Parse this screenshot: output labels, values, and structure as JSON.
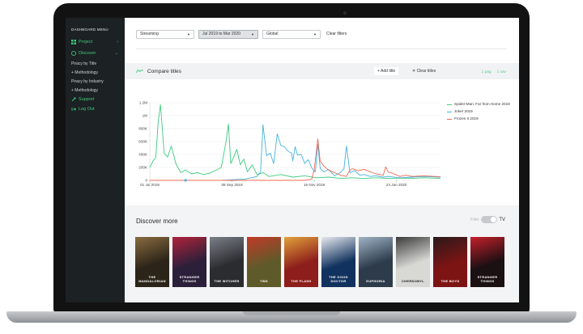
{
  "sidebar": {
    "title": "DASHBOARD MENU",
    "items": [
      {
        "label": "Project",
        "icon": "grid-icon"
      },
      {
        "label": "Discover",
        "icon": "compass-icon"
      }
    ],
    "discover_sub": [
      {
        "label": "Piracy by Title"
      },
      {
        "label": "+ Methodology"
      },
      {
        "label": "Piracy by Industry"
      },
      {
        "label": "+ Methodology"
      }
    ],
    "support": {
      "label": "Support",
      "icon": "support-icon"
    },
    "logout": {
      "label": "Log Out",
      "icon": "logout-icon"
    }
  },
  "filters": {
    "type": "Streaming",
    "date": "Jul 2019 to Mar 2020",
    "region": "Global",
    "clear": "Clear filters"
  },
  "compare": {
    "title": "Compare titles",
    "add": "+ Add title",
    "clear": "✕  Clear titles",
    "png": "⇩ png",
    "csv": "⇩ csv"
  },
  "chart_data": {
    "type": "line",
    "title": "",
    "xlabel": "",
    "ylabel": "",
    "x_ticks": [
      "01 Jul 2019",
      "08 Sep 2019",
      "16 Nov 2019",
      "24 Jan 2020"
    ],
    "y_ticks": [
      "0",
      "200K",
      "400K",
      "600K",
      "800K",
      "1M",
      "1.2M"
    ],
    "ylim": [
      0,
      1200000
    ],
    "x_range_days": [
      0,
      244
    ],
    "series": [
      {
        "name": "Spider-Man: Far from Home 2019",
        "color": "#3ecb7e",
        "x": [
          0,
          3,
          5,
          7,
          9,
          12,
          15,
          18,
          22,
          26,
          30,
          35,
          40,
          45,
          50,
          55,
          60,
          64,
          66,
          68,
          70,
          73,
          76,
          79,
          82,
          86,
          90,
          95,
          100,
          110,
          120,
          130,
          140,
          150,
          160,
          170,
          180,
          190,
          200,
          210,
          220,
          230,
          244
        ],
        "y": [
          200000,
          310000,
          350000,
          900000,
          1170000,
          420000,
          360000,
          530000,
          250000,
          120000,
          160000,
          100000,
          120000,
          90000,
          110000,
          150000,
          200000,
          600000,
          870000,
          260000,
          340000,
          480000,
          240000,
          330000,
          130000,
          240000,
          90000,
          120000,
          60000,
          90000,
          50000,
          70000,
          40000,
          50000,
          30000,
          40000,
          30000,
          40000,
          30000,
          35000,
          30000,
          40000,
          30000
        ]
      },
      {
        "name": "Joker 2019",
        "color": "#46b3de",
        "x": [
          0,
          20,
          40,
          60,
          70,
          80,
          90,
          93,
          95,
          98,
          101,
          104,
          107,
          110,
          113,
          116,
          119,
          120,
          122,
          124,
          127,
          130,
          133,
          136,
          139,
          141,
          143,
          146,
          150,
          155,
          160,
          163,
          165,
          168,
          172,
          176,
          180,
          185,
          190,
          196,
          200,
          210,
          220,
          230,
          244
        ],
        "y": [
          0,
          0,
          0,
          0,
          10000,
          20000,
          60000,
          130000,
          860000,
          380000,
          420000,
          260000,
          720000,
          540000,
          520000,
          450000,
          420000,
          300000,
          520000,
          390000,
          400000,
          260000,
          320000,
          190000,
          130000,
          560000,
          190000,
          130000,
          170000,
          70000,
          120000,
          180000,
          530000,
          120000,
          150000,
          80000,
          90000,
          60000,
          70000,
          50000,
          60000,
          40000,
          50000,
          60000,
          50000
        ]
      },
      {
        "name": "Frozen II 2019",
        "color": "#ec6b55",
        "x": [
          0,
          50,
          100,
          120,
          130,
          133,
          136,
          138,
          141,
          143,
          146,
          150,
          155,
          160,
          165,
          168,
          170,
          175,
          180,
          185,
          190,
          196,
          198,
          200,
          205,
          210,
          215,
          220,
          230,
          244
        ],
        "y": [
          0,
          0,
          0,
          0,
          0,
          10000,
          20000,
          160000,
          640000,
          300000,
          220000,
          160000,
          120000,
          80000,
          60000,
          160000,
          180000,
          150000,
          170000,
          130000,
          100000,
          80000,
          210000,
          130000,
          100000,
          60000,
          80000,
          60000,
          70000,
          55000
        ]
      }
    ],
    "grid": true,
    "legend": "right"
  },
  "discover": {
    "title": "Discover more",
    "film_label": "Film",
    "tv_label": "TV",
    "posters": [
      {
        "label": "THE MANDALORIAN",
        "bg": "#2b2418",
        "accent": "#8a6c40"
      },
      {
        "label": "STRANGER THINGS",
        "bg": "#2b1f3a",
        "accent": "#b0233a"
      },
      {
        "label": "THE WITCHER",
        "bg": "#2a2c30",
        "accent": "#7c8088"
      },
      {
        "label": "TWD",
        "bg": "#5e5a2a",
        "accent": "#c23a27"
      },
      {
        "label": "THE FLASH",
        "bg": "#8d1e1b",
        "accent": "#e2a13b"
      },
      {
        "label": "THE GOOD DOCTOR",
        "bg": "#11325e",
        "accent": "#e7eaf0"
      },
      {
        "label": "EUPHORIA",
        "bg": "#2d3b4a",
        "accent": "#9fb3c6"
      },
      {
        "label": "CHERNOBYL",
        "bg": "#d8d8d4",
        "accent": "#3a3a3a"
      },
      {
        "label": "THE BOYS",
        "bg": "#7d1414",
        "accent": "#2a1a1a"
      },
      {
        "label": "STRANGER THINGS",
        "bg": "#1b1012",
        "accent": "#c51f2b"
      }
    ]
  }
}
